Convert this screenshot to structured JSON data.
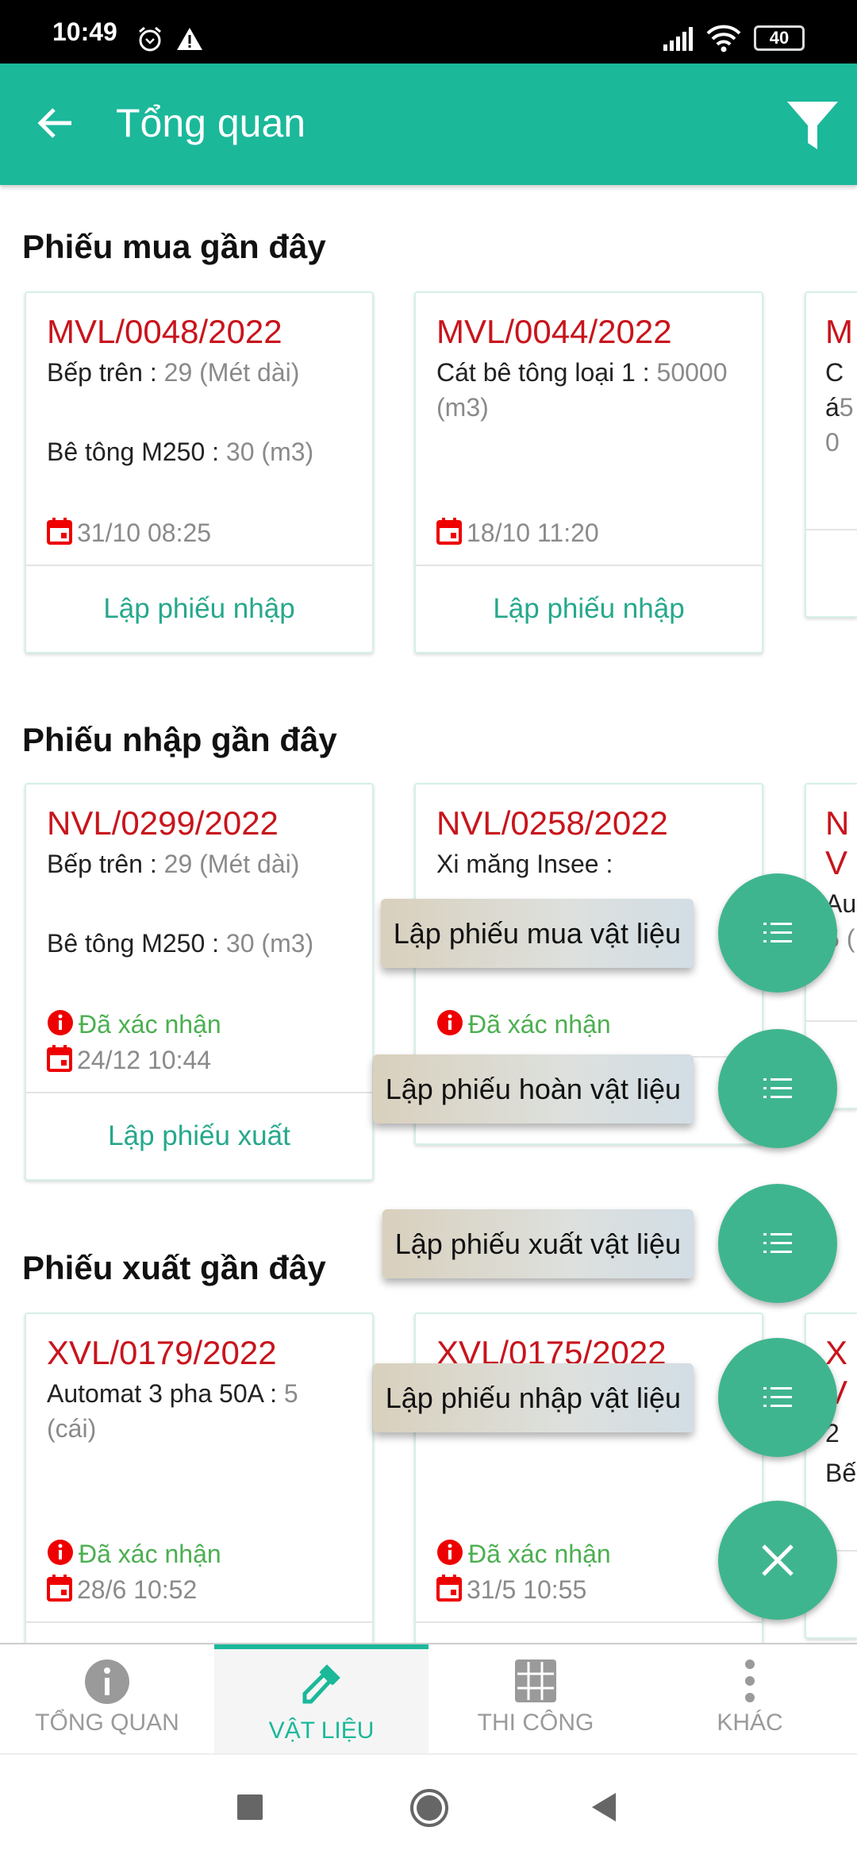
{
  "status_bar": {
    "time": "10:49",
    "battery": "40"
  },
  "header": {
    "title": "Tổng quan",
    "back_icon": "arrow-left-icon",
    "filter_icon": "filter-icon"
  },
  "colors": {
    "primary": "#1bb89a",
    "code": "#c8141c",
    "status": "#4caf50",
    "fab": "#3fb58f"
  },
  "sections": [
    {
      "title": "Phiếu mua gần đây",
      "cards": [
        {
          "code": "MVL/0048/2022",
          "items": [
            {
              "name": "Bếp trên : ",
              "qty": "29 (Mét dài)"
            },
            {
              "name": "Bê tông M250 : ",
              "qty": "30 (m3)"
            }
          ],
          "date": "31/10 08:25",
          "action": "Lập phiếu nhập"
        },
        {
          "code": "MVL/0044/2022",
          "items": [
            {
              "name": "Cát bê tông loại 1 : ",
              "qty": "50000 (m3)"
            }
          ],
          "date": "18/10 11:20",
          "action": "Lập phiếu nhập"
        },
        {
          "code": "M",
          "items": [
            {
              "name": "Cá",
              "qty": "50"
            }
          ],
          "date": "",
          "action": ""
        }
      ]
    },
    {
      "title": "Phiếu nhập gần đây",
      "cards": [
        {
          "code": "NVL/0299/2022",
          "items": [
            {
              "name": "Bếp trên : ",
              "qty": "29 (Mét dài)"
            },
            {
              "name": "Bê tông M250 : ",
              "qty": "30 (m3)"
            }
          ],
          "status": "Đã xác nhận",
          "date": "24/12 10:44",
          "action": "Lập phiếu xuất"
        },
        {
          "code": "NVL/0258/2022",
          "items": [
            {
              "name": "Xi măng Insee : ",
              "qty": ""
            }
          ],
          "status": "Đã xác nhận",
          "date": "",
          "action": "Lập phiếu xuất"
        },
        {
          "code": "NV",
          "items": [
            {
              "name": "Au",
              "qty": "5 ("
            }
          ],
          "status": "",
          "date": "",
          "action": ""
        }
      ]
    },
    {
      "title": "Phiếu xuất gần đây",
      "cards": [
        {
          "code": "XVL/0179/2022",
          "items": [
            {
              "name": "Automat 3 pha 50A : ",
              "qty": "5 (cái)"
            }
          ],
          "status": "Đã xác nhận",
          "date": "28/6 10:52",
          "action": ""
        },
        {
          "code": "XVL/0175/2022",
          "items": [],
          "status": "Đã xác nhận",
          "date": "31/5 10:55",
          "action": ""
        },
        {
          "code": "XV",
          "items": [
            {
              "name": "2",
              "qty": ""
            },
            {
              "name": "Bế",
              "qty": ""
            }
          ],
          "status": "",
          "date": "",
          "action": ""
        }
      ]
    }
  ],
  "speed_dial": {
    "actions": [
      "Lập phiếu mua vật liệu",
      "Lập phiếu hoàn vật liệu",
      "Lập phiếu xuất vật liệu",
      "Lập phiếu nhập vật liệu"
    ],
    "action_icon": "list-icon",
    "close_icon": "close-icon"
  },
  "bottom_nav": {
    "active": "VẬT LIỆU",
    "tabs": [
      {
        "label": "TỔNG QUAN",
        "icon": "info-icon"
      },
      {
        "label": "VẬT LIỆU",
        "icon": "eyedropper-icon"
      },
      {
        "label": "THI CÔNG",
        "icon": "grid-icon"
      },
      {
        "label": "KHÁC",
        "icon": "more-vertical-icon"
      }
    ]
  }
}
